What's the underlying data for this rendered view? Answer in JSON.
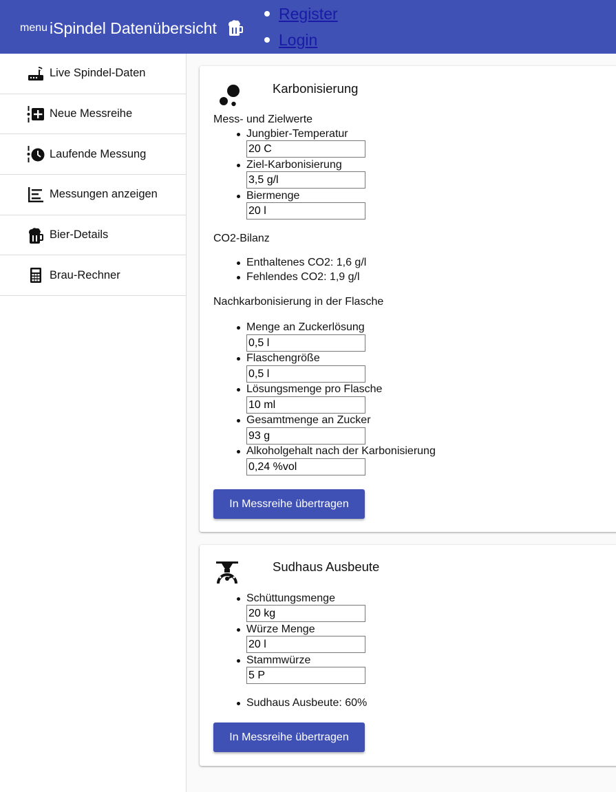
{
  "header": {
    "menu_label": "menu",
    "title": "iSpindel Datenübersicht",
    "title_icon": "beer-mug-icon",
    "nav": [
      {
        "label": "Register"
      },
      {
        "label": "Login"
      }
    ],
    "color": "#3f51b5"
  },
  "sidebar": {
    "items": [
      {
        "label": "Live Spindel-Daten",
        "icon": "router-icon"
      },
      {
        "label": "Neue Messreihe",
        "icon": "timeline-add-icon"
      },
      {
        "label": "Laufende Messung",
        "icon": "timeline-clock-icon"
      },
      {
        "label": "Messungen anzeigen",
        "icon": "bar-chart-icon"
      },
      {
        "label": "Bier-Details",
        "icon": "beer-mug-icon"
      },
      {
        "label": "Brau-Rechner",
        "icon": "calculator-icon"
      }
    ]
  },
  "carbonation": {
    "title": "Karbonisierung",
    "icon": "bubbles-icon",
    "measure_heading": "Mess- und Zielwerte",
    "fields": [
      {
        "label": "Jungbier-Temperatur",
        "value": "20 C"
      },
      {
        "label": "Ziel-Karbonisierung",
        "value": "3,5 g/l"
      },
      {
        "label": "Biermenge",
        "value": "20 l"
      }
    ],
    "co2_heading": "CO2-Bilanz",
    "co2_items": [
      "Enthaltenes CO2: 1,6 g/l",
      "Fehlendes CO2: 1,9 g/l"
    ],
    "bottle_heading": "Nachkarbonisierung in der Flasche",
    "bottle_fields": [
      {
        "label": "Menge an Zuckerlösung",
        "value": "0,5 l"
      },
      {
        "label": "Flaschengröße",
        "value": "0,5 l"
      },
      {
        "label": "Lösungsmenge pro Flasche",
        "value": "10 ml"
      },
      {
        "label": "Gesamtmenge an Zucker",
        "value": "93 g"
      },
      {
        "label": "Alkoholgehalt nach der Karbonisierung",
        "value": "0,24 %vol"
      }
    ],
    "button_label": "In Messreihe übertragen"
  },
  "brewhouse": {
    "title": "Sudhaus Ausbeute",
    "icon": "scale-icon",
    "fields": [
      {
        "label": "Schüttungsmenge",
        "value": "20 kg"
      },
      {
        "label": "Würze Menge",
        "value": "20 l"
      },
      {
        "label": "Stammwürze",
        "value": "5 P"
      }
    ],
    "result": "Sudhaus Ausbeute: 60%",
    "button_label": "In Messreihe übertragen"
  }
}
